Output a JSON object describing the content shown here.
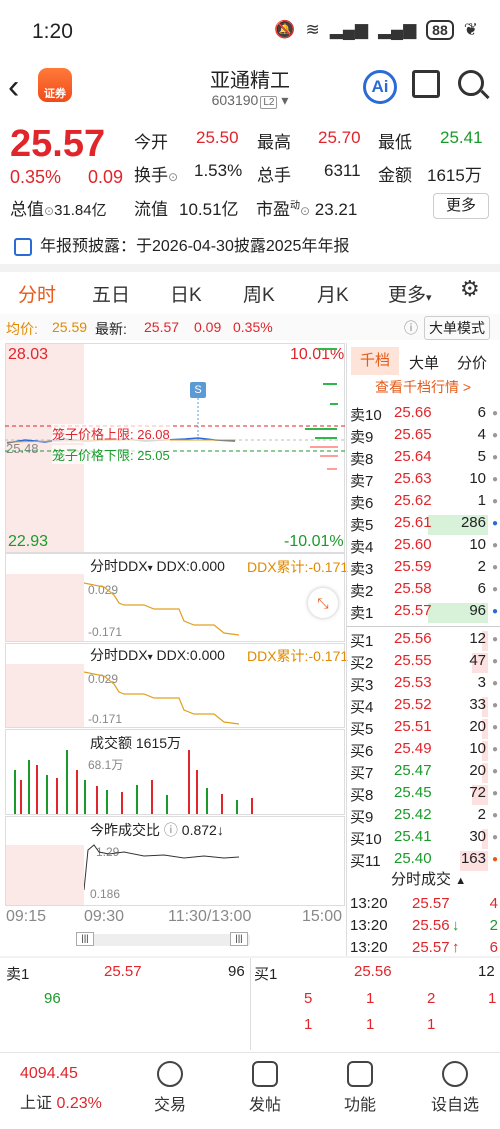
{
  "status": {
    "time": "1:20",
    "battery": "88"
  },
  "header": {
    "title": "亚通精工",
    "code": "603190",
    "level": "L2",
    "logo_text": "证券",
    "ai": "Ai"
  },
  "quote": {
    "price": "25.57",
    "chg_pct": "0.35%",
    "chg": "0.09",
    "labels": {
      "open": "今开",
      "high": "最高",
      "low": "最低",
      "turnover": "换手",
      "vol": "总手",
      "amount": "金额",
      "mcap": "总值",
      "float": "流值",
      "pe": "市盈"
    },
    "open": "25.50",
    "high": "25.70",
    "low": "25.41",
    "turnover": "1.53%",
    "vol": "6311",
    "amount": "1615万",
    "mcap": "31.84亿",
    "float": "10.51亿",
    "pe_sup": "动",
    "pe": "23.21",
    "more": "更多"
  },
  "notice": "年报预披露：于2026-04-30披露2025年年报",
  "tabs": [
    "分时",
    "五日",
    "日K",
    "周K",
    "月K",
    "更多"
  ],
  "info": {
    "avg_label": "均价:",
    "avg": "25.59",
    "latest_label": "最新:",
    "latest": "25.57",
    "chg": "0.09",
    "pct": "0.35%",
    "mode": "大单模式"
  },
  "chart": {
    "high": "28.03",
    "low": "22.93",
    "up_pct": "10.01%",
    "down_pct": "-10.01%",
    "mid": "25.48",
    "upper_limit": "笼子价格上限: 26.08",
    "lower_limit": "笼子价格下限: 25.05",
    "marker": "S"
  },
  "ddx1": {
    "name": "分时DDX",
    "ddx": "DDX:0.000",
    "cum": "DDX累计:-0.171",
    "top": "0.029",
    "bot": "-0.171"
  },
  "ddx2": {
    "name": "分时DDX",
    "ddx": "DDX:0.000",
    "cum": "DDX累计:-0.171",
    "top": "0.029",
    "bot": "-0.171"
  },
  "volume": {
    "name": "成交额",
    "value": "1615万",
    "max": "68.1万"
  },
  "ratio": {
    "name": "今昨成交比",
    "value": "0.872",
    "arrow": "↓",
    "top": "1.29",
    "bot": "0.186"
  },
  "times": [
    "09:15",
    "09:30",
    "11:30/13:00",
    "15:00"
  ],
  "order": {
    "tabs": [
      "千档",
      "大单",
      "分价"
    ],
    "link": "查看千档行情 >",
    "asks": [
      [
        "卖10",
        "25.66",
        "6"
      ],
      [
        "卖9",
        "25.65",
        "4"
      ],
      [
        "卖8",
        "25.64",
        "5"
      ],
      [
        "卖7",
        "25.63",
        "10"
      ],
      [
        "卖6",
        "25.62",
        "1"
      ],
      [
        "卖5",
        "25.61",
        "286"
      ],
      [
        "卖4",
        "25.60",
        "10"
      ],
      [
        "卖3",
        "25.59",
        "2"
      ],
      [
        "卖2",
        "25.58",
        "6"
      ],
      [
        "卖1",
        "25.57",
        "96"
      ]
    ],
    "bids": [
      [
        "买1",
        "25.56",
        "12"
      ],
      [
        "买2",
        "25.55",
        "47"
      ],
      [
        "买3",
        "25.53",
        "3"
      ],
      [
        "买4",
        "25.52",
        "33"
      ],
      [
        "买5",
        "25.51",
        "20"
      ],
      [
        "买6",
        "25.49",
        "10"
      ],
      [
        "买7",
        "25.47",
        "20"
      ],
      [
        "买8",
        "25.45",
        "72"
      ],
      [
        "买9",
        "25.42",
        "2"
      ],
      [
        "买10",
        "25.41",
        "30"
      ],
      [
        "买11",
        "25.40",
        "163"
      ]
    ],
    "trades_title": "分时成交",
    "trades": [
      [
        "13:20",
        "25.57",
        "",
        "4"
      ],
      [
        "13:20",
        "25.56",
        "↓",
        "2"
      ],
      [
        "13:20",
        "25.57",
        "↑",
        "6"
      ]
    ]
  },
  "queue": {
    "sell_label": "卖1",
    "sell_price": "25.57",
    "sell_qty": "96",
    "sell_q": [
      "96"
    ],
    "buy_label": "买1",
    "buy_price": "25.56",
    "buy_qty": "12",
    "buy_q1": [
      "5",
      "1",
      "2",
      "1"
    ],
    "buy_q2": [
      "1",
      "1",
      "1"
    ]
  },
  "nav": {
    "index_value": "4094.45",
    "index_name": "上证",
    "index_pct": "0.23%",
    "items": [
      "交易",
      "发帖",
      "功能",
      "设自选"
    ]
  }
}
